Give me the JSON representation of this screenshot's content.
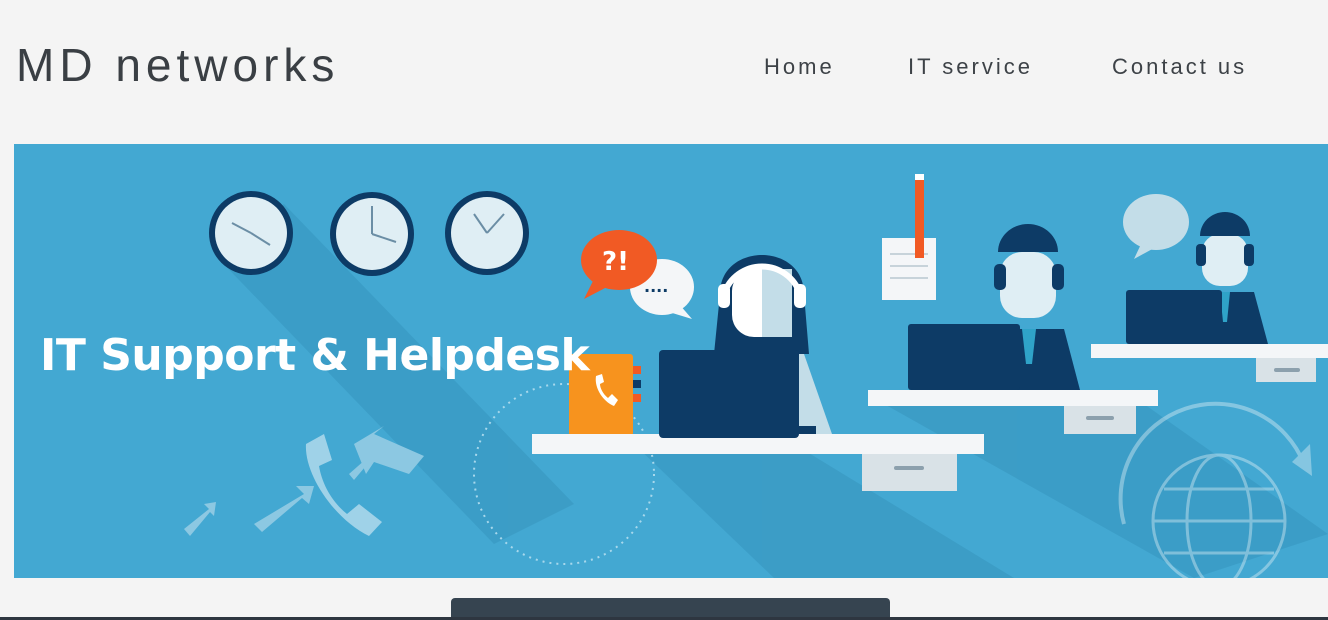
{
  "header": {
    "site_title": "MD networks",
    "nav": {
      "home": "Home",
      "it_service": "IT service",
      "contact": "Contact us"
    }
  },
  "banner": {
    "title": "IT Support & Helpdesk",
    "bubble_text": "?!",
    "bubble_dots": "....",
    "colors": {
      "background": "#43a8d2",
      "accent": "#f15a24",
      "navy": "#0d3b66"
    }
  }
}
